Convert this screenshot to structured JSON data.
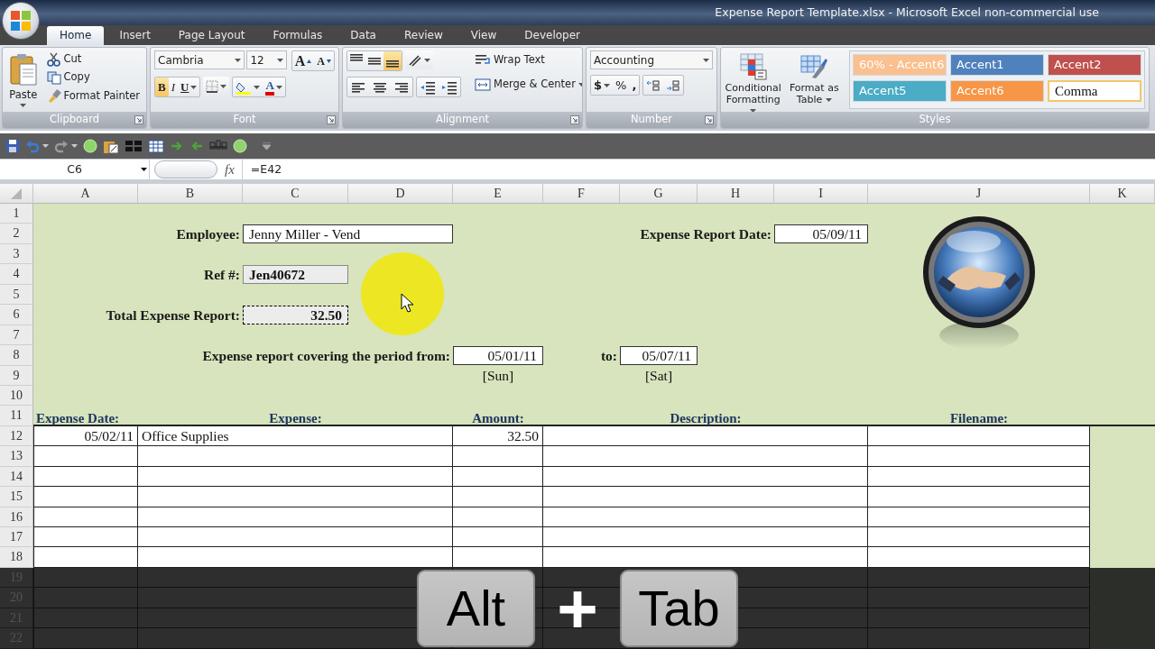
{
  "window": {
    "title": "Expense Report Template.xlsx - Microsoft Excel non-commercial use"
  },
  "ribbon_tabs": [
    {
      "label": "Home",
      "selected": true
    },
    {
      "label": "Insert",
      "selected": false
    },
    {
      "label": "Page Layout",
      "selected": false
    },
    {
      "label": "Formulas",
      "selected": false
    },
    {
      "label": "Data",
      "selected": false
    },
    {
      "label": "Review",
      "selected": false
    },
    {
      "label": "View",
      "selected": false
    },
    {
      "label": "Developer",
      "selected": false
    }
  ],
  "clipboard": {
    "paste": "Paste",
    "cut": "Cut",
    "copy": "Copy",
    "format_painter": "Format Painter",
    "group_label": "Clipboard"
  },
  "font": {
    "font_name": "Cambria",
    "font_size": "12",
    "grow": "A",
    "shrink": "A",
    "bold": {
      "label": "B",
      "on": true
    },
    "italic": {
      "label": "I",
      "on": false
    },
    "underline": {
      "label": "U",
      "on": false
    },
    "font_color": "A",
    "group_label": "Font"
  },
  "alignment": {
    "vertical": [
      {
        "kind": "top",
        "on": false
      },
      {
        "kind": "middle",
        "on": false
      },
      {
        "kind": "bottom",
        "on": true
      }
    ],
    "wrap_text": "Wrap Text",
    "merge_center": "Merge & Center",
    "group_label": "Alignment"
  },
  "number": {
    "format": "Accounting",
    "currency": "$",
    "percent": "%",
    "comma": ",",
    "group_label": "Number"
  },
  "styles": {
    "conditional_formatting": "Conditional Formatting",
    "format_as_table": "Format as Table",
    "group_label": "Styles",
    "cell_styles": [
      {
        "label": "60% - Accent6",
        "color": "#fac090",
        "highlighted": false
      },
      {
        "label": "Accent1",
        "color": "#4f81bd",
        "highlighted": false
      },
      {
        "label": "Accent2",
        "color": "#c0504d",
        "highlighted": false
      },
      {
        "label": "Accent5",
        "color": "#4bacc6",
        "highlighted": false
      },
      {
        "label": "Accent6",
        "color": "#f79646",
        "highlighted": false
      },
      {
        "label": "Comma",
        "color": "#ffffff",
        "highlighted": true
      }
    ]
  },
  "formula_bar": {
    "name_box": "C6",
    "function_label": "fx",
    "formula": "=E42"
  },
  "columns": [
    "A",
    "B",
    "C",
    "D",
    "E",
    "F",
    "G",
    "H",
    "I",
    "J",
    "K"
  ],
  "row_numbers": [
    "1",
    "2",
    "3",
    "4",
    "5",
    "6",
    "7",
    "8",
    "9",
    "10",
    "11",
    "12",
    "13",
    "14",
    "15",
    "16",
    "17",
    "18",
    "19",
    "20",
    "21",
    "22"
  ],
  "fields": [
    {
      "label": "Employee:",
      "value": "Jenny Miller - Vend",
      "kind": "box",
      "selected": false
    },
    {
      "label": "Expense Report Date:",
      "value": "05/09/11",
      "kind": "box",
      "selected": false
    },
    {
      "label": "Ref #:",
      "value": "Jen40672",
      "kind": "shaded",
      "selected": false
    },
    {
      "label": "Total Expense Report:",
      "value": "32.50",
      "kind": "shaded",
      "selected": true
    },
    {
      "label": "Expense report covering the period from:",
      "value": "05/01/11",
      "kind": "box",
      "selected": false,
      "note": "[Sun]"
    },
    {
      "label": "to:",
      "value": "05/07/11",
      "kind": "box",
      "selected": false,
      "note": "[Sat]"
    }
  ],
  "table": {
    "headers": [
      "Expense Date:",
      "Expense:",
      "Amount:",
      "Description:",
      "Filename:"
    ],
    "rows": [
      {
        "cells": [
          "05/02/11",
          "Office Supplies",
          "32.50"
        ]
      }
    ]
  },
  "shortcut": {
    "keys": [
      "Alt",
      "Tab"
    ],
    "joiner": "+"
  }
}
